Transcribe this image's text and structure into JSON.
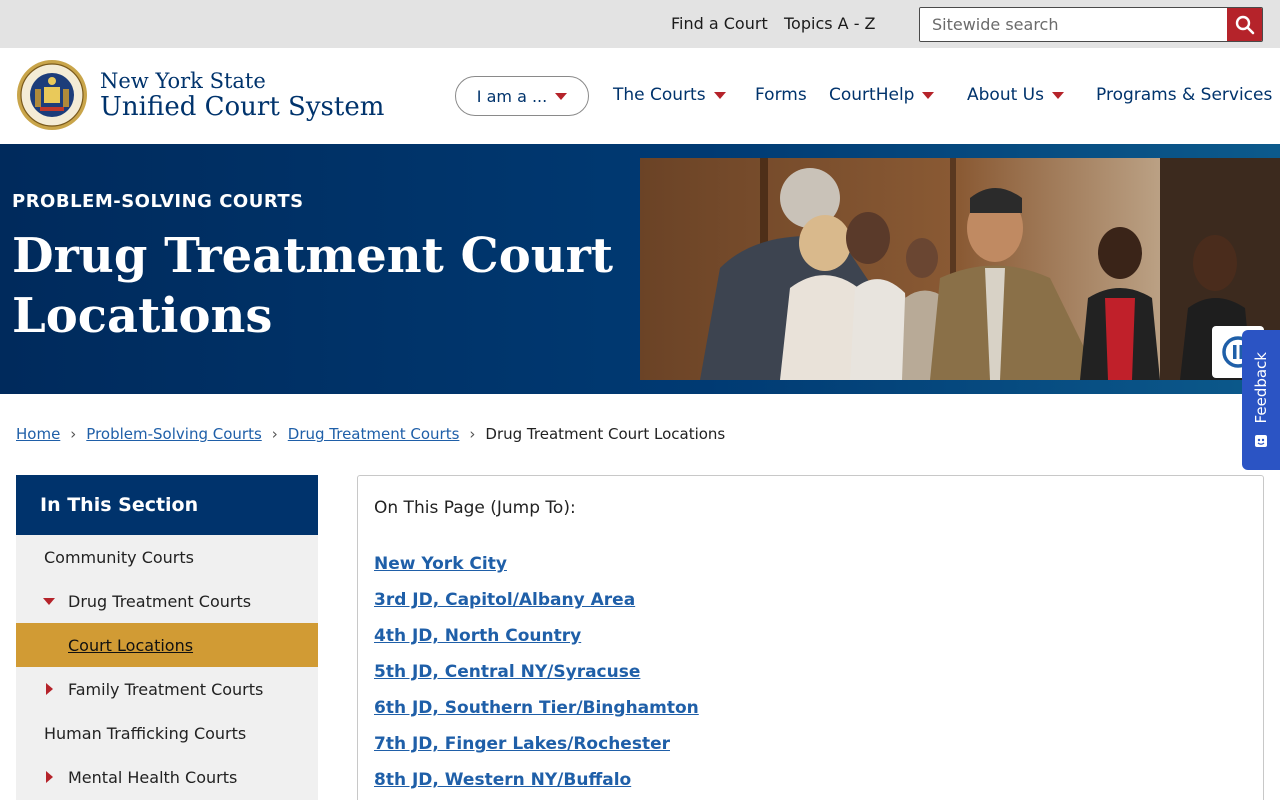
{
  "utility": {
    "find_court": "Find a Court",
    "topics": "Topics A - Z",
    "search_placeholder": "Sitewide search",
    "search_icon": "search-icon"
  },
  "brand": {
    "line1": "New York State",
    "line2": "Unified Court System",
    "seal_icon": "nys-seal-icon"
  },
  "nav": {
    "iam": "I am a ...",
    "items": [
      {
        "label": "The Courts",
        "has_menu": true
      },
      {
        "label": "Forms",
        "has_menu": false
      },
      {
        "label": "CourtHelp",
        "has_menu": true
      },
      {
        "label": "About Us",
        "has_menu": true
      },
      {
        "label": "Programs & Services",
        "has_menu": false
      }
    ]
  },
  "hero": {
    "eyebrow": "PROBLEM-SOLVING COURTS",
    "title": "Drug Treatment Court Locations",
    "pause_icon": "pause-icon"
  },
  "feedback": {
    "label": "Feedback"
  },
  "breadcrumb": {
    "items": [
      "Home",
      "Problem-Solving Courts",
      "Drug Treatment Courts"
    ],
    "current": "Drug Treatment Court Locations"
  },
  "sidebar": {
    "heading": "In This Section",
    "items": [
      {
        "label": "Community Courts"
      },
      {
        "label": "Drug Treatment Courts"
      },
      {
        "label": "Court Locations"
      },
      {
        "label": "Family Treatment Courts"
      },
      {
        "label": "Human Trafficking Courts"
      },
      {
        "label": "Mental Health Courts"
      }
    ]
  },
  "jump": {
    "heading": "On This Page (Jump To):",
    "links": [
      "New York City",
      "3rd JD, Capitol/Albany Area",
      "4th JD, North Country",
      "5th JD, Central NY/Syracuse",
      "6th JD, Southern Tier/Binghamton",
      "7th JD, Finger Lakes/Rochester",
      "8th JD, Western NY/Buffalo"
    ]
  },
  "colors": {
    "navy": "#00336c",
    "accent_red": "#b5232a",
    "active_gold": "#d19b34",
    "link_blue": "#1f5fa8",
    "feedback_blue": "#2b54c4"
  }
}
